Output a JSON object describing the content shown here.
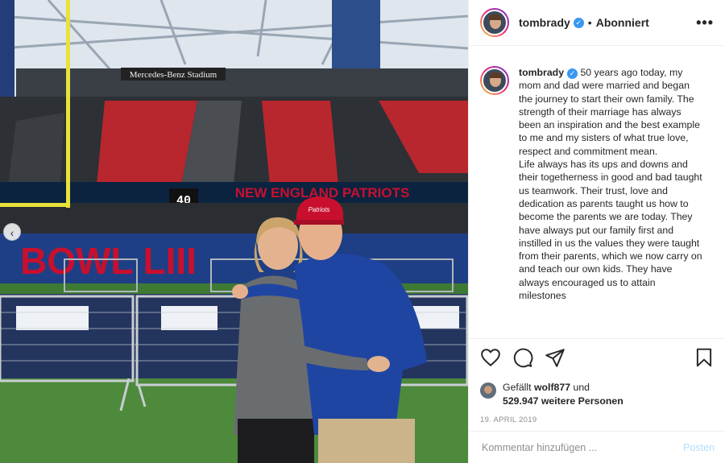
{
  "header": {
    "username": "tombrady",
    "verified_mark": "✓",
    "separator": "•",
    "follow_state": "Abonniert",
    "more_label": "•••"
  },
  "photo": {
    "stadium_sign": "Mercedes-Benz Stadium",
    "banner_text": "NEW ENGLAND PATRIOTS",
    "yard_marker": "40",
    "bowl_text": "BOWL LIII",
    "cap_logo": "Patriots",
    "carousel_prev_icon": "‹"
  },
  "caption": {
    "username": "tombrady",
    "text": "50 years ago today, my mom and dad were married and began the journey to start their own family. The strength of their marriage has always been an inspiration and the best example to me and my sisters of what true love, respect and commitment mean.\nLife always has its ups and downs and their togetherness in good and bad taught us teamwork. Their trust, love and dedication as parents taught us how to become the parents we are today. They have always put our family first and instilled in us the values they were taught from their parents, which we now carry on and teach our own kids. They have always encouraged us to attain milestones"
  },
  "actions": {
    "icons": [
      "heart-icon",
      "comment-icon",
      "share-icon",
      "bookmark-icon"
    ]
  },
  "likes": {
    "prefix": "Gefällt",
    "first_liker": "wolf877",
    "connector": "und",
    "count_text": "529.947 weitere Personen"
  },
  "date": "19. APRIL 2019",
  "comment": {
    "placeholder": "Kommentar hinzufügen ...",
    "post_label": "Posten"
  },
  "colors": {
    "verified_blue": "#3897f0",
    "post_disabled": "#b2dffc",
    "muted_text": "#8e8e8e",
    "patriots_red": "#c8102e",
    "patriots_navy": "#0c2340"
  }
}
